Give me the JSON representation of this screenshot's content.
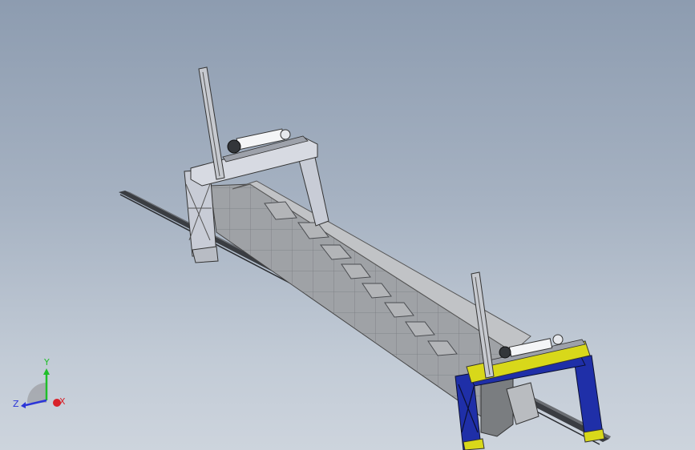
{
  "viewport": {
    "background_top": "#8d9cb0",
    "background_bottom": "#cdd4dd"
  },
  "model": {
    "frame_gray": "#c8ccd6",
    "frame_blue": "#1f2fa8",
    "frame_yellow": "#d8d81a",
    "trough_gray": "#a9abae",
    "rail_dark": "#3a3d42"
  },
  "triad": {
    "y_label": "Y",
    "z_label": "Z",
    "x_label": "X",
    "y_color": "#1fbf2a",
    "z_color": "#2b35d8",
    "x_color": "#d8222a"
  }
}
